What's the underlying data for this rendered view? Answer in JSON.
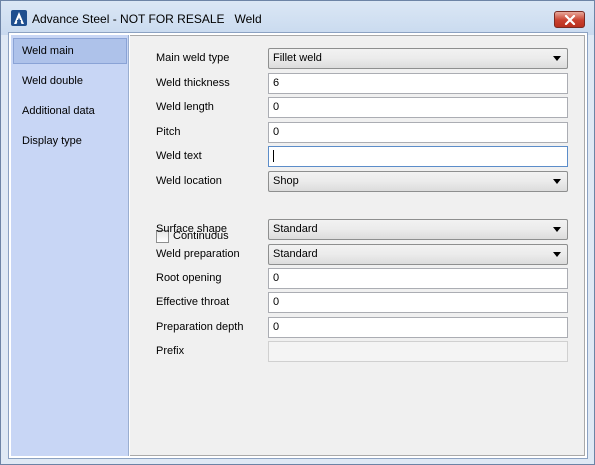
{
  "window": {
    "title": "Advance Steel - NOT FOR RESALE   Weld",
    "app_icon": "advance-steel-logo"
  },
  "sidebar": {
    "items": [
      {
        "label": "Weld main",
        "active": true
      },
      {
        "label": "Weld double",
        "active": false
      },
      {
        "label": "Additional data",
        "active": false
      },
      {
        "label": "Display type",
        "active": false
      }
    ]
  },
  "form": {
    "main_weld_type": {
      "label": "Main weld type",
      "value": "Fillet weld"
    },
    "weld_thickness": {
      "label": "Weld thickness",
      "value": "6"
    },
    "weld_length": {
      "label": "Weld length",
      "value": "0"
    },
    "pitch": {
      "label": "Pitch",
      "value": "0"
    },
    "weld_text": {
      "label": "Weld text",
      "value": ""
    },
    "weld_location": {
      "label": "Weld location",
      "value": "Shop"
    },
    "continuous": {
      "label": "Continuous",
      "checked": false
    },
    "surface_shape": {
      "label": "Surface shape",
      "value": "Standard"
    },
    "weld_preparation": {
      "label": "Weld preparation",
      "value": "Standard"
    },
    "root_opening": {
      "label": "Root opening",
      "value": "0"
    },
    "effective_throat": {
      "label": "Effective throat",
      "value": "0"
    },
    "preparation_depth": {
      "label": "Preparation depth",
      "value": "0"
    },
    "prefix": {
      "label": "Prefix",
      "value": ""
    }
  },
  "colors": {
    "accent": "#aec2ea",
    "sidebar_bg": "#c8d6f5",
    "close_button": "#c9412f"
  }
}
